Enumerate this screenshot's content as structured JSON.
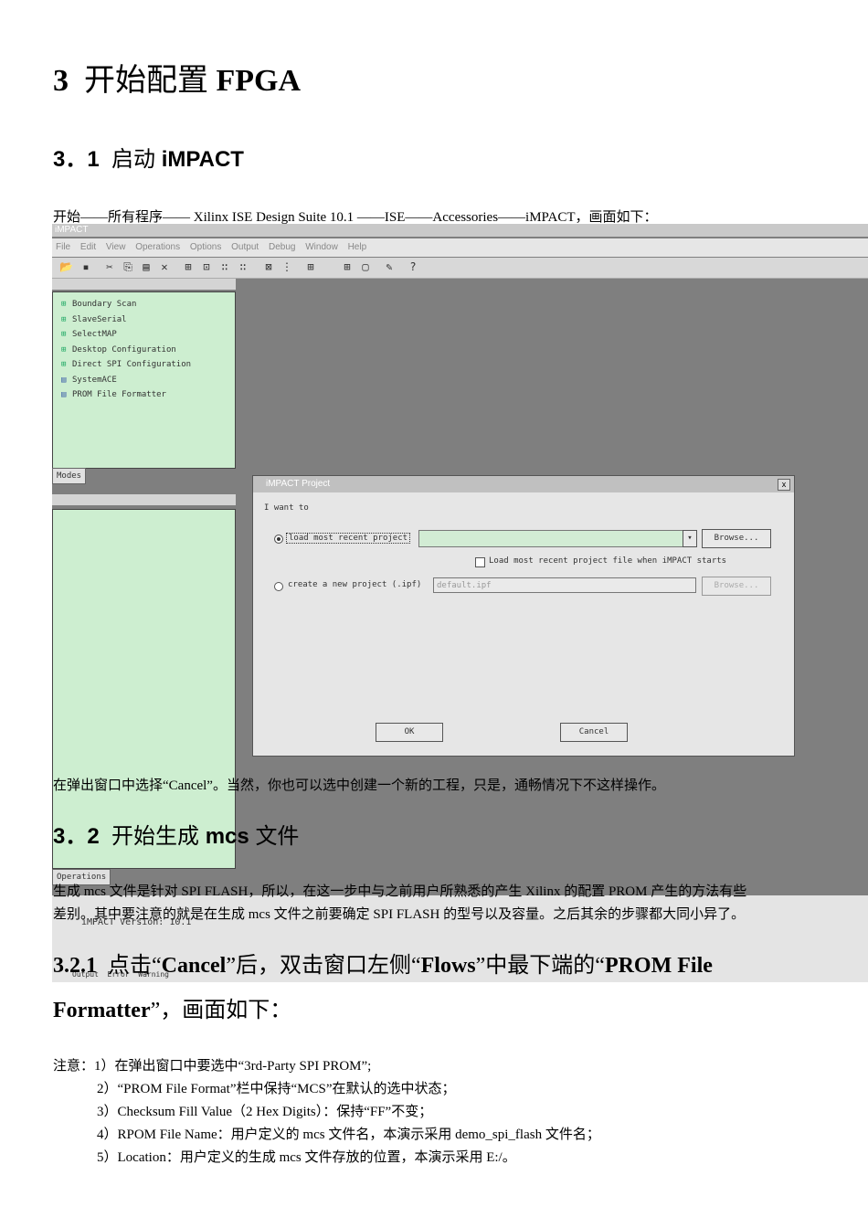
{
  "heading1": {
    "num": "3",
    "cn": "开始配置",
    "en": "FPGA"
  },
  "section1": {
    "num": "3．1",
    "cn": "启动",
    "en": "iMPACT"
  },
  "path_line": "开始——所有程序—— Xilinx ISE Design Suite 10.1 ——ISE——Accessories——iMPACT，画面如下：",
  "screenshot": {
    "title": "iMPACT",
    "menu": [
      "File",
      "Edit",
      "View",
      "Operations",
      "Options",
      "Output",
      "Debug",
      "Window",
      "Help"
    ],
    "tree_items": [
      "Boundary Scan",
      "SlaveSerial",
      "SelectMAP",
      "Desktop Configuration",
      "Direct SPI Configuration",
      "SystemACE",
      "PROM File Formatter"
    ],
    "modes_tab": "Modes",
    "operations_tab": "Operations",
    "console_text": "iMPACT Version: 10.1",
    "bottom_tabs": [
      "Output",
      "Error",
      "Warning"
    ],
    "dialog": {
      "title": "iMPACT Project",
      "close": "x",
      "prompt": "I want to",
      "option1": "load most recent project",
      "browse1": "Browse...",
      "checkbox": "Load most recent project file when iMPACT starts",
      "option2": "create a new project (.ipf)",
      "new_file": "default.ipf",
      "browse2": "Browse...",
      "ok": "OK",
      "cancel": "Cancel"
    }
  },
  "para_cancel": "在弹出窗口中选择“Cancel”。当然，你也可以选中创建一个新的工程，只是，通畅情况下不这样操作。",
  "section2": {
    "num": "3．2",
    "cn": "开始生成",
    "en": "mcs",
    "cn2": "文件"
  },
  "para_mcs_1": "生成 mcs 文件是针对 SPI FLASH，所以，在这一步中与之前用户所熟悉的产生 Xilinx 的配置 PROM 产生的方法有些",
  "para_mcs_2": "差别。其中要注意的就是在生成 mcs 文件之前要确定 SPI FLASH 的型号以及容量。之后其余的步骤都大同小异了。",
  "section3_line1": {
    "num": "3.2.1",
    "a": "点击“",
    "b": "Cancel",
    "c": "”后，双击窗口左侧“",
    "d": "Flows",
    "e": "”中最下端的“",
    "f": "PROM File"
  },
  "section3_line2": {
    "a": "Formatter",
    "b": "”，画面如下："
  },
  "notes": [
    "注意：1）在弹出窗口中要选中“3rd-Party SPI PROM”;",
    "2）“PROM File Format”栏中保持“MCS”在默认的选中状态；",
    "3）Checksum Fill Value（2 Hex Digits）：保持“FF”不变；",
    "4）RPOM File Name：用户定义的 mcs 文件名，本演示采用 demo_spi_flash 文件名；",
    "5）Location：用户定义的生成 mcs 文件存放的位置，本演示采用 E:/。"
  ]
}
